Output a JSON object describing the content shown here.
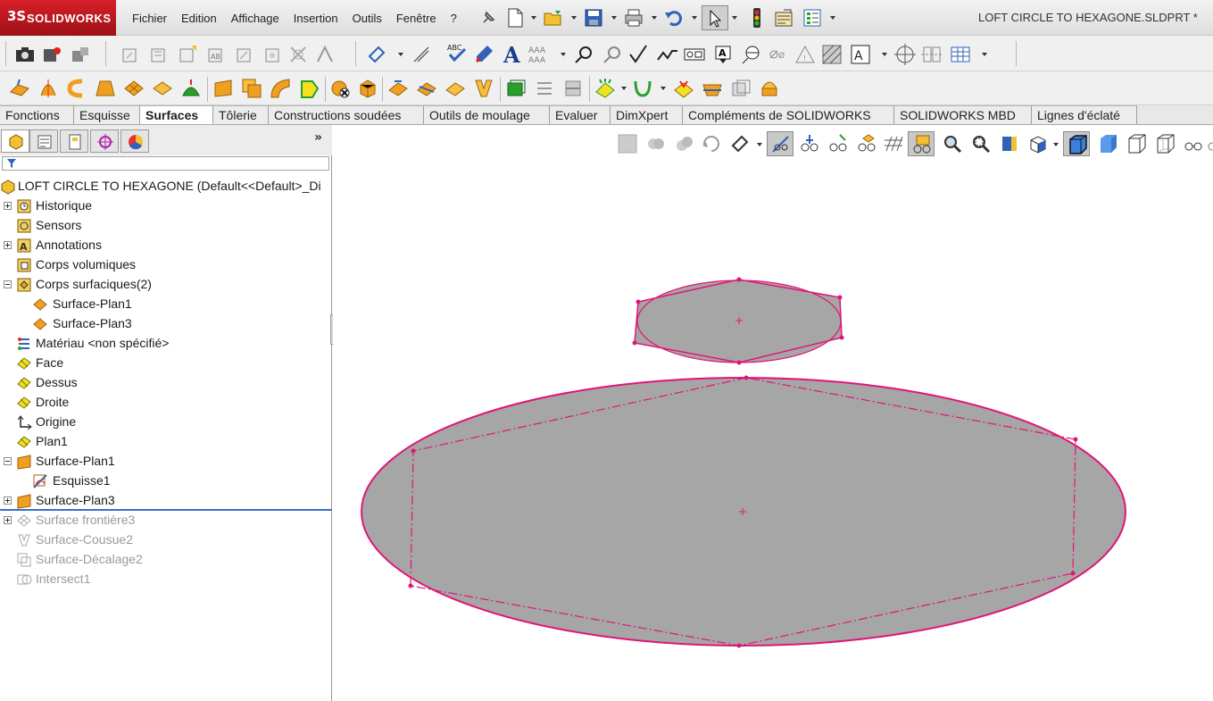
{
  "app": {
    "brand": "SOLIDWORKS",
    "brand_prefix": "3S",
    "document_title": "LOFT CIRCLE TO HEXAGONE.SLDPRT *"
  },
  "menu": [
    "Fichier",
    "Edition",
    "Affichage",
    "Insertion",
    "Outils",
    "Fenêtre",
    "?"
  ],
  "command_tabs": [
    {
      "label": "Fonctions",
      "active": false
    },
    {
      "label": "Esquisse",
      "active": false
    },
    {
      "label": "Surfaces",
      "active": true
    },
    {
      "label": "Tôlerie",
      "active": false
    },
    {
      "label": "Constructions soudées",
      "active": false
    },
    {
      "label": "Outils de moulage",
      "active": false
    },
    {
      "label": "Evaluer",
      "active": false
    },
    {
      "label": "DimXpert",
      "active": false
    },
    {
      "label": "Compléments de SOLIDWORKS",
      "active": false
    },
    {
      "label": "SOLIDWORKS MBD",
      "active": false
    },
    {
      "label": "Lignes d'éclaté",
      "active": false
    }
  ],
  "panel": {
    "more": "»",
    "tree": [
      {
        "label": "LOFT CIRCLE TO HEXAGONE  (Default<<Default>_Di",
        "icon": "part-icon",
        "dim": false
      },
      {
        "label": "Historique",
        "icon": "history-icon",
        "dim": false
      },
      {
        "label": "Sensors",
        "icon": "sensors-icon",
        "dim": false
      },
      {
        "label": "Annotations",
        "icon": "annotations-icon",
        "dim": false
      },
      {
        "label": "Corps volumiques",
        "icon": "solid-bodies-icon",
        "dim": false
      },
      {
        "label": "Corps surfaciques(2)",
        "icon": "surface-bodies-icon",
        "dim": false
      },
      {
        "label": "Surface-Plan1",
        "icon": "surface-body-icon",
        "dim": false
      },
      {
        "label": "Surface-Plan3",
        "icon": "surface-body-icon",
        "dim": false
      },
      {
        "label": "Matériau <non spécifié>",
        "icon": "material-icon",
        "dim": false
      },
      {
        "label": "Face",
        "icon": "plane-icon",
        "dim": false
      },
      {
        "label": "Dessus",
        "icon": "plane-icon",
        "dim": false
      },
      {
        "label": "Droite",
        "icon": "plane-icon",
        "dim": false
      },
      {
        "label": "Origine",
        "icon": "origin-icon",
        "dim": false
      },
      {
        "label": "Plan1",
        "icon": "plane-icon",
        "dim": false
      },
      {
        "label": "Surface-Plan1",
        "icon": "planar-surface-icon",
        "dim": false
      },
      {
        "label": "Esquisse1",
        "icon": "sketch-icon",
        "dim": false
      },
      {
        "label": "Surface-Plan3",
        "icon": "planar-surface-icon",
        "dim": false
      },
      {
        "label": "Surface frontière3",
        "icon": "boundary-surface-icon",
        "dim": true
      },
      {
        "label": "Surface-Cousue2",
        "icon": "knit-surface-icon",
        "dim": true
      },
      {
        "label": "Surface-Décalage2",
        "icon": "offset-surface-icon",
        "dim": true
      },
      {
        "label": "Intersect1",
        "icon": "intersect-icon",
        "dim": true
      }
    ]
  },
  "colors": {
    "sketch_pink": "#e0157a",
    "surface_gray": "#a6a6a6",
    "tree_selection_line": "#3d6fc4",
    "logo_red": "#c8141d"
  }
}
